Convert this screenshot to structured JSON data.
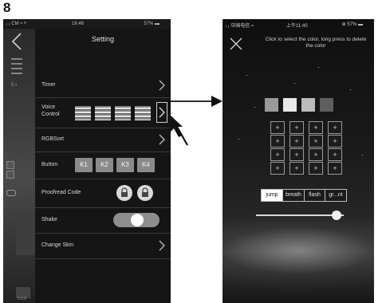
{
  "step_number": "8",
  "left_screen": {
    "status": {
      "carrier": "ᵢ ₁ CM ≈ ᵠ",
      "time": "16:46",
      "battery_text": "57% ▬"
    },
    "title": "Setting",
    "side": {
      "page_indicator": "5 ▪",
      "footer": "2.0.0"
    },
    "rows": {
      "timer": "Timer",
      "voice_control_line1": "Voice",
      "voice_control_line2": "Control",
      "rgbsort": "RGBSort",
      "button": "Button",
      "keys": [
        "K1",
        "K2",
        "K3",
        "K4"
      ],
      "proofread_code": "Proofread Code",
      "shake": "Shake",
      "change_skin": "Change Skin"
    },
    "shake_enabled": true
  },
  "right_screen": {
    "status": {
      "carrier": "ᵢ ₁ 中国电信 ≈",
      "time": "上午11:40",
      "battery_text": "⊕ 57% ▬"
    },
    "instruction": "Click to select the color, long press to delete the color",
    "swatch_colors": [
      "#9a9a9a",
      "#e8e8e8",
      "#bcbcbc",
      "#5e5e5e"
    ],
    "grid_rows": [
      [
        "+",
        "+",
        "+",
        "+"
      ],
      [
        "+",
        "+",
        "+",
        "+"
      ],
      [
        "+",
        "+",
        "+",
        "+"
      ],
      [
        "+",
        "+",
        "+",
        "+"
      ]
    ],
    "modes": [
      "jump",
      "breath",
      "flash",
      "gr...nt"
    ],
    "active_mode": "jump",
    "slider_value_fraction": 0.92
  }
}
